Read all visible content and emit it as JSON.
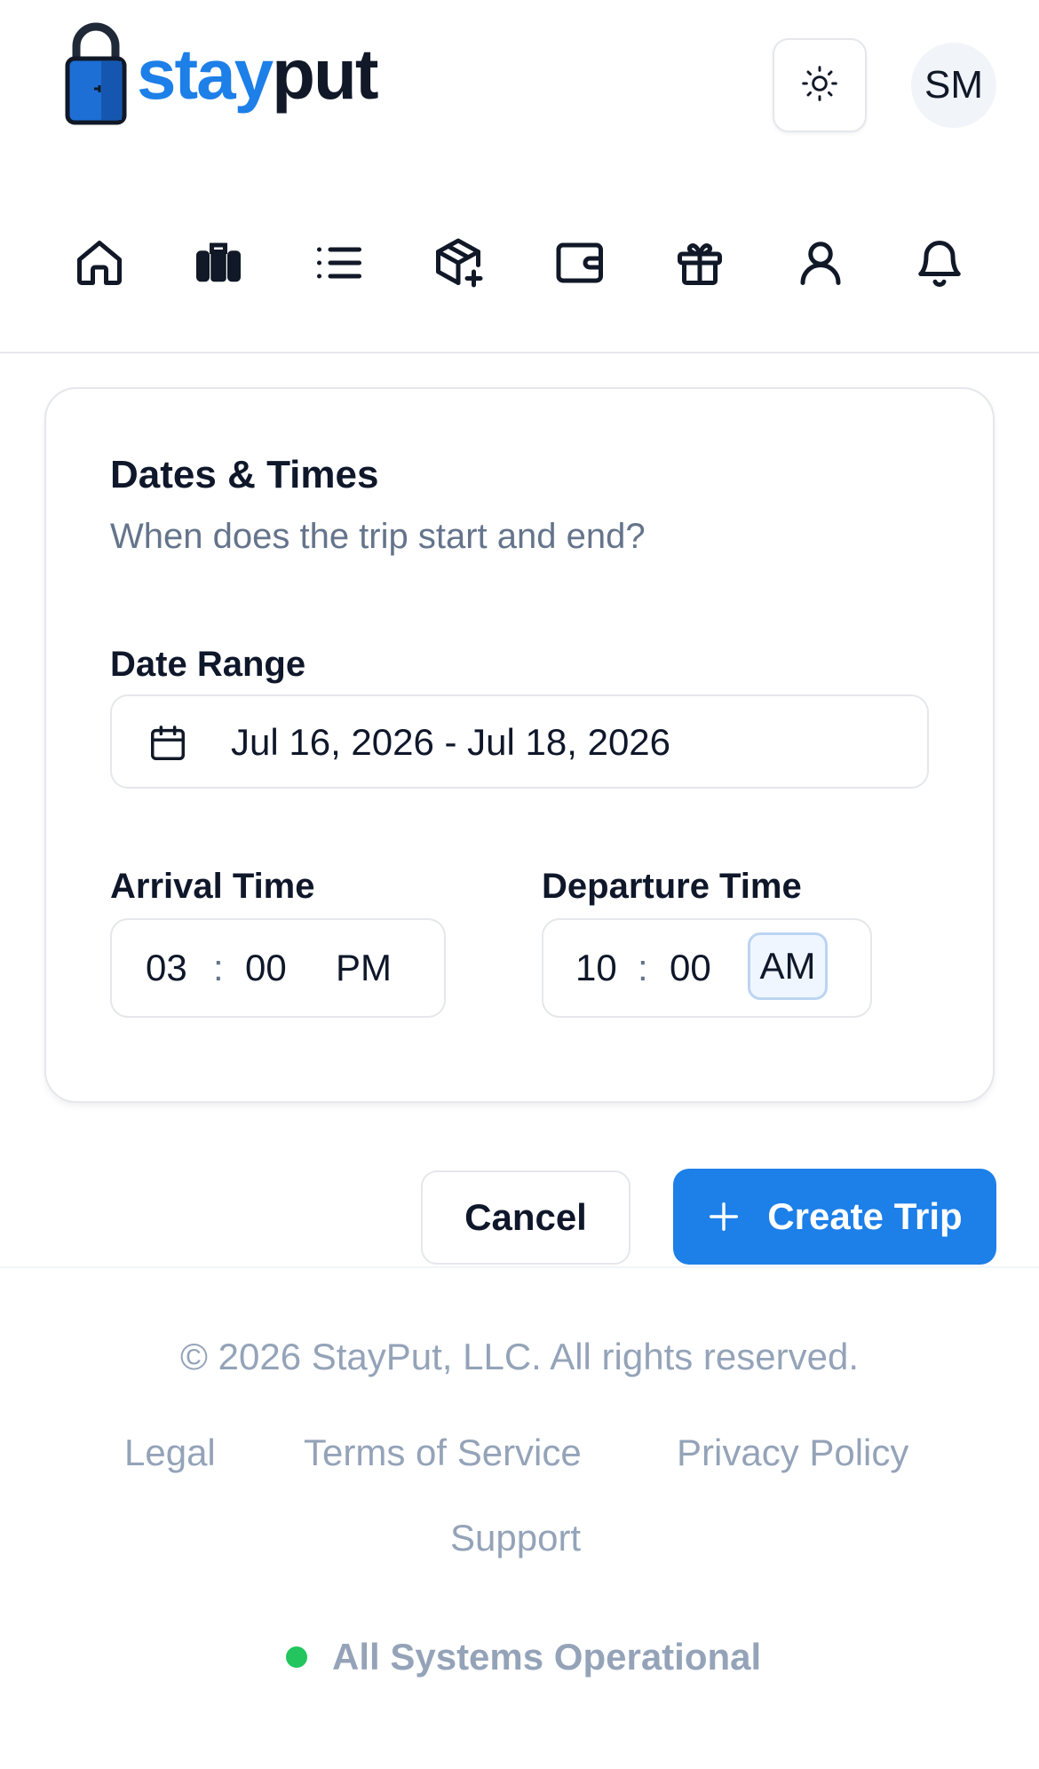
{
  "header": {
    "logo_stay": "stay",
    "logo_put": "put",
    "theme_icon": "sun-icon",
    "avatar_initials": "SM"
  },
  "nav": {
    "items": [
      {
        "icon": "home-icon"
      },
      {
        "icon": "luggage-icon"
      },
      {
        "icon": "list-icon"
      },
      {
        "icon": "package-plus-icon"
      },
      {
        "icon": "wallet-icon"
      },
      {
        "icon": "gift-icon"
      },
      {
        "icon": "user-icon"
      },
      {
        "icon": "bell-icon"
      }
    ]
  },
  "card": {
    "title": "Dates & Times",
    "subtitle": "When does the trip start and end?",
    "date_range_label": "Date Range",
    "date_range_value": "Jul 16, 2026 - Jul 18, 2026",
    "arrival_label": "Arrival Time",
    "arrival": {
      "hour": "03",
      "minute": "00",
      "period": "PM"
    },
    "departure_label": "Departure Time",
    "departure": {
      "hour": "10",
      "minute": "00",
      "period": "AM"
    },
    "colon": ":"
  },
  "actions": {
    "cancel_label": "Cancel",
    "create_label": "Create Trip"
  },
  "footer": {
    "copyright": "© 2026 StayPut, LLC. All rights reserved.",
    "links": [
      "Legal",
      "Terms of Service",
      "Privacy Policy",
      "Support"
    ],
    "status_text": "All Systems Operational",
    "status_color": "#22c55e"
  },
  "colors": {
    "brand": "#1d7fe8",
    "muted_text": "#64748b",
    "footer_text": "#94a3b8"
  }
}
